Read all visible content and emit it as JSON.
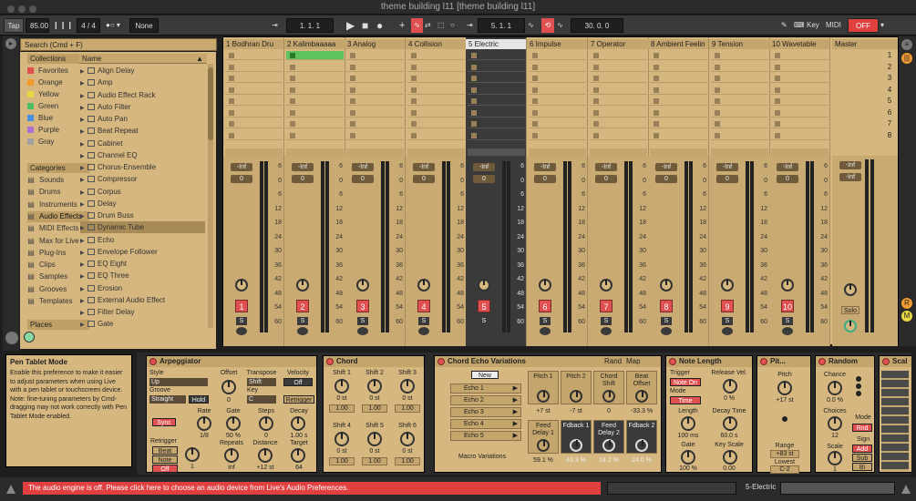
{
  "window": {
    "title": "theme building l11  [theme building l11]"
  },
  "control_bar": {
    "tap": "Tap",
    "tempo": "85.00",
    "time_signature": "4 / 4",
    "quantize": "None",
    "position": "1.  1.  1",
    "loop_start": "5.  1.  1",
    "loop_length": "30.  0.  0",
    "key_label": "Key",
    "midi_label": "MIDI",
    "cpu": "OFF"
  },
  "browser": {
    "search_placeholder": "Search (Cmd + F)",
    "collections_header": "Collections",
    "collections": [
      {
        "label": "Favorites",
        "color": "#e05050"
      },
      {
        "label": "Orange",
        "color": "#f09a30"
      },
      {
        "label": "Yellow",
        "color": "#e6d840"
      },
      {
        "label": "Green",
        "color": "#4cc060"
      },
      {
        "label": "Blue",
        "color": "#4a90e0"
      },
      {
        "label": "Purple",
        "color": "#b070d8"
      },
      {
        "label": "Gray",
        "color": "#a0a0a0"
      }
    ],
    "categories_header": "Categories",
    "categories": [
      {
        "label": "Sounds",
        "icon": "music-note-icon"
      },
      {
        "label": "Drums",
        "icon": "drum-icon"
      },
      {
        "label": "Instruments",
        "icon": "instrument-icon"
      },
      {
        "label": "Audio Effects",
        "icon": "audio-effects-icon"
      },
      {
        "label": "MIDI Effects",
        "icon": "midi-effects-icon"
      },
      {
        "label": "Max for Live",
        "icon": "max-icon"
      },
      {
        "label": "Plug-Ins",
        "icon": "plugin-icon"
      },
      {
        "label": "Clips",
        "icon": "clip-icon"
      },
      {
        "label": "Samples",
        "icon": "waveform-icon"
      },
      {
        "label": "Grooves",
        "icon": "groove-icon"
      },
      {
        "label": "Templates",
        "icon": "template-icon"
      }
    ],
    "places_header": "Places",
    "name_column": "Name",
    "items": [
      "Align Delay",
      "Amp",
      "Audio Effect Rack",
      "Auto Filter",
      "Auto Pan",
      "Beat Repeat",
      "Cabinet",
      "Channel EQ",
      "Chorus-Ensemble",
      "Compressor",
      "Corpus",
      "Delay",
      "Drum Buss",
      "Dynamic Tube",
      "Echo",
      "Envelope Follower",
      "EQ Eight",
      "EQ Three",
      "Erosion",
      "External Audio Effect",
      "Filter Delay",
      "Gate"
    ]
  },
  "session": {
    "tracks": [
      {
        "name": "1 Bodhran Dru",
        "num": "1",
        "vol": "-Inf",
        "pan": "0"
      },
      {
        "name": "2 Kalimbaaaaa",
        "num": "2",
        "vol": "-Inf",
        "pan": "0"
      },
      {
        "name": "3 Analog",
        "num": "3",
        "vol": "-Inf",
        "pan": "0"
      },
      {
        "name": "4 Collision",
        "num": "4",
        "vol": "-Inf",
        "pan": "0"
      },
      {
        "name": "5 Electric",
        "num": "5",
        "vol": "-Inf",
        "pan": "0"
      },
      {
        "name": "6 Impulse",
        "num": "6",
        "vol": "-Inf",
        "pan": "0"
      },
      {
        "name": "7 Operator",
        "num": "7",
        "vol": "-Inf",
        "pan": "0"
      },
      {
        "name": "8 Ambient Feelin",
        "num": "8",
        "vol": "-Inf",
        "pan": "0"
      },
      {
        "name": "9 Tension",
        "num": "9",
        "vol": "-Inf",
        "pan": "0"
      },
      {
        "name": "10 Wavetable",
        "num": "10",
        "vol": "-Inf",
        "pan": "0"
      }
    ],
    "master": {
      "name": "Master",
      "vol": "-Inf",
      "pan": "-Inf",
      "solo": "Solo"
    },
    "scenes": [
      "1",
      "2",
      "3",
      "4",
      "5",
      "6",
      "7",
      "8"
    ],
    "db_scale": [
      "6",
      "0",
      "6",
      "12",
      "18",
      "24",
      "30",
      "36",
      "42",
      "48",
      "54",
      "60"
    ],
    "s_label": "S"
  },
  "info": {
    "title": "Pen Tablet Mode",
    "text": "Enable this preference to make it easier to adjust parameters when using Live with a pen tablet or touchscreen device. Note: fine-tuning parameters by Cmd-dragging may not work correctly with Pen Tablet Mode enabled."
  },
  "devices": {
    "arpeggiator": {
      "title": "Arpeggiator",
      "style_label": "Style",
      "style": "Up",
      "groove_label": "Groove",
      "groove": "Straight",
      "hold": "Hold",
      "offset_label": "Offset",
      "offset": "0",
      "transpose_label": "Transpose",
      "transpose": "Shift",
      "key_label": "Key",
      "key": "C",
      "velocity_label": "Velocity",
      "velocity": "Off",
      "retrigger_btn": "Retrigger",
      "sync": "Sync",
      "rate_label": "Rate",
      "rate": "1/8",
      "gate_label": "Gate",
      "gate": "50 %",
      "steps_label": "Steps",
      "steps": "0",
      "decay_label": "Decay",
      "decay": "1.00 s",
      "retrigger_label": "Retrigger",
      "rt_beat": "Beat",
      "rt_note": "Note",
      "rt_off": "Off",
      "rt_value": "1",
      "repeats_label": "Repeats",
      "repeats": "inf",
      "distance_label": "Distance",
      "distance": "+12 st",
      "target_label": "Target",
      "target": "64"
    },
    "chord": {
      "title": "Chord",
      "shifts": [
        {
          "label": "Shift 1",
          "val": "0 st",
          "vel": "1.00"
        },
        {
          "label": "Shift 2",
          "val": "0 st",
          "vel": "1.00"
        },
        {
          "label": "Shift 3",
          "val": "0 st",
          "vel": "1.00"
        },
        {
          "label": "Shift 4",
          "val": "0 st",
          "vel": "1.00"
        },
        {
          "label": "Shift 5",
          "val": "0 st",
          "vel": "1.00"
        },
        {
          "label": "Shift 6",
          "val": "0 st",
          "vel": "1.00"
        }
      ]
    },
    "chord_echo": {
      "title": "Chord Echo Variations",
      "rand": "Rand",
      "map": "Map",
      "new": "New",
      "chains": [
        "Echo 1",
        "Echo 2",
        "Echo 3",
        "Echo 4",
        "Echo 5"
      ],
      "macro_variations": "Macro Variations",
      "macros": [
        {
          "label": "Pitch 1",
          "val": "+7 st",
          "dark": false
        },
        {
          "label": "Pitch 2",
          "val": "-7 st",
          "dark": false
        },
        {
          "label": "Chord Shift",
          "val": "0",
          "dark": false
        },
        {
          "label": "Beat Offset",
          "val": "-33.3 %",
          "dark": false
        },
        {
          "label": "Feed Delay 1",
          "val": "59.1 %",
          "dark": false
        },
        {
          "label": "Fdback 1",
          "val": "43.3 %",
          "dark": true
        },
        {
          "label": "Feed Delay 2",
          "val": "14.2 %",
          "dark": true
        },
        {
          "label": "Fdback 2",
          "val": "24.0 %",
          "dark": true
        }
      ]
    },
    "note_length": {
      "title": "Note Length",
      "trigger_label": "Trigger",
      "trigger": "Note On",
      "mode_label": "Mode",
      "mode": "Time",
      "release_label": "Release Vel.",
      "release": "0 %",
      "length_label": "Length",
      "length": "100 ms",
      "decay_label": "Decay Time",
      "decay": "60.0 s",
      "gate_label": "Gate",
      "gate": "100 %",
      "keyscale_label": "Key Scale",
      "keyscale": "0.00"
    },
    "pitch": {
      "title": "Pit...",
      "pitch_label": "Pitch",
      "pitch": "+17 st",
      "range_label": "Range",
      "range": "+83 st",
      "lowest_label": "Lowest",
      "lowest": "C-2"
    },
    "random": {
      "title": "Random",
      "chance_label": "Chance",
      "chance": "0.0 %",
      "choices_label": "Choices",
      "choices": "12",
      "mode_label": "Mode",
      "mode": "Rnd",
      "scale_label": "Scale",
      "scale": "1",
      "sign_label": "Sign",
      "sign_add": "Add",
      "sign_sub": "Sub",
      "sign_bi": "Bi"
    },
    "scale": {
      "title": "Scal"
    }
  },
  "status": {
    "message": "The audio engine is off. Please click here to choose an audio device from Live's Audio Preferences.",
    "selected_track": "5-Electric"
  }
}
